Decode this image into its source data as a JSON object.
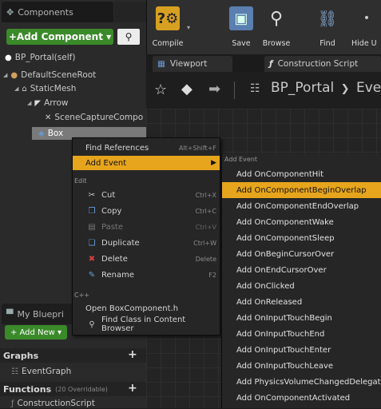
{
  "components_panel": {
    "tab_title": "Components",
    "add_component_label": "+Add Component ▾",
    "tree": [
      {
        "label": "BP_Portal(self)"
      },
      {
        "label": "DefaultSceneRoot"
      },
      {
        "label": "StaticMesh"
      },
      {
        "label": "Arrow"
      },
      {
        "label": "SceneCaptureCompo"
      },
      {
        "label": "Box"
      }
    ]
  },
  "my_blueprint": {
    "tab_title": "My Bluepri",
    "add_new_label": "+ Add New ▾",
    "graphs_label": "Graphs",
    "event_graph_label": "EventGraph",
    "functions_label": "Functions",
    "functions_count": "(20 Overridable)",
    "construction_script_label": "ConstructionScript"
  },
  "toolbar": {
    "compile": "Compile",
    "save": "Save",
    "browse": "Browse",
    "find": "Find",
    "hide": "Hide U"
  },
  "editor_tabs": {
    "viewport": "Viewport",
    "construction_script": "Construction Script"
  },
  "breadcrumb": {
    "blueprint": "BP_Portal",
    "separator": "❯",
    "graph": "Even"
  },
  "context_menu": {
    "find_references": {
      "label": "Find References",
      "shortcut": "Alt+Shift+F"
    },
    "add_event": {
      "label": "Add Event"
    },
    "edit_category": "Edit",
    "cut": {
      "label": "Cut",
      "shortcut": "Ctrl+X"
    },
    "copy": {
      "label": "Copy",
      "shortcut": "Ctrl+C"
    },
    "paste": {
      "label": "Paste",
      "shortcut": "Ctrl+V"
    },
    "duplicate": {
      "label": "Duplicate",
      "shortcut": "Ctrl+W"
    },
    "delete": {
      "label": "Delete",
      "shortcut": "Delete"
    },
    "rename": {
      "label": "Rename",
      "shortcut": "F2"
    },
    "cpp_category": "C++",
    "open_header": {
      "label": "Open BoxComponent.h"
    },
    "find_class": {
      "label": "Find Class in Content Browser"
    }
  },
  "add_event_submenu": {
    "header": "Add Event",
    "items": [
      "Add OnComponentHit",
      "Add OnComponentBeginOverlap",
      "Add OnComponentEndOverlap",
      "Add OnComponentWake",
      "Add OnComponentSleep",
      "Add OnBeginCursorOver",
      "Add OnEndCursorOver",
      "Add OnClicked",
      "Add OnReleased",
      "Add OnInputTouchBegin",
      "Add OnInputTouchEnd",
      "Add OnInputTouchEnter",
      "Add OnInputTouchLeave",
      "Add PhysicsVolumeChangedDelegate",
      "Add OnComponentActivated"
    ],
    "highlighted_index": 1
  },
  "colors": {
    "highlight": "#e6a51c",
    "add_button_green": "#3a8a2a",
    "background": "#1c1c1c"
  },
  "icons": [
    "components-icon",
    "search-icon",
    "compile-icon",
    "save-icon",
    "browse-icon",
    "find-icon",
    "star-icon",
    "back-arrow-icon",
    "forward-arrow-icon",
    "graph-icon",
    "function-icon",
    "viewport-icon"
  ]
}
